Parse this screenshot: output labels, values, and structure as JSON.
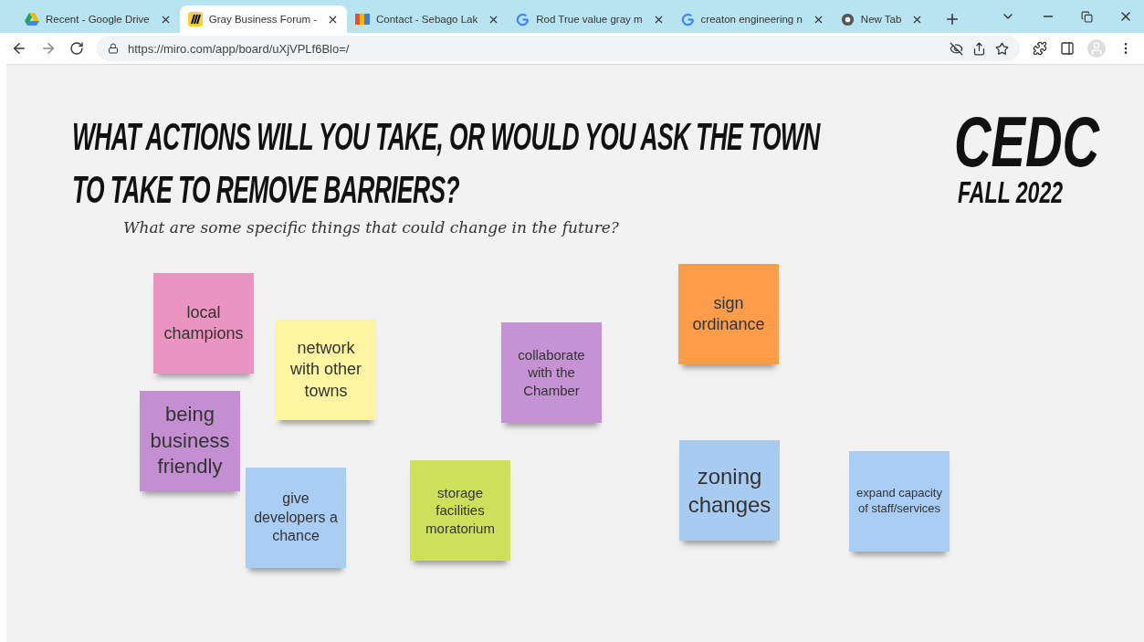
{
  "tabs": [
    {
      "title": "Recent - Google Drive",
      "selected": false
    },
    {
      "title": "Gray Business Forum -",
      "selected": true
    },
    {
      "title": "Contact - Sebago Lak",
      "selected": false
    },
    {
      "title": "Rod True value gray m",
      "selected": false
    },
    {
      "title": "creaton engineering n",
      "selected": false
    },
    {
      "title": "New Tab",
      "selected": false
    }
  ],
  "address_bar": {
    "url": "https://miro.com/app/board/uXjVPLf6Blo=/"
  },
  "board": {
    "title": "WHAT ACTIONS WILL YOU TAKE, OR WOULD YOU ASK THE TOWN TO TAKE TO REMOVE BARRIERS?",
    "logo": "CEDC",
    "logo_subtitle": "FALL 2022",
    "subtitle": "What are some specific things that could change in the future?",
    "notes": [
      {
        "text": "local champions",
        "color": "#ea94c0"
      },
      {
        "text": "network with other towns",
        "color": "#fdf5a2"
      },
      {
        "text": "being business friendly",
        "color": "#c38fd1"
      },
      {
        "text": "give developers a chance",
        "color": "#a9cdf3"
      },
      {
        "text": "storage facilities moratorium",
        "color": "#cde05c"
      },
      {
        "text": "collaborate with the Chamber",
        "color": "#c592d3"
      },
      {
        "text": "sign ordinance",
        "color": "#fd9d4a"
      },
      {
        "text": "zoning changes",
        "color": "#a8cbf2"
      },
      {
        "text": "expand capacity of staff/services",
        "color": "#a9cdf3"
      }
    ]
  }
}
